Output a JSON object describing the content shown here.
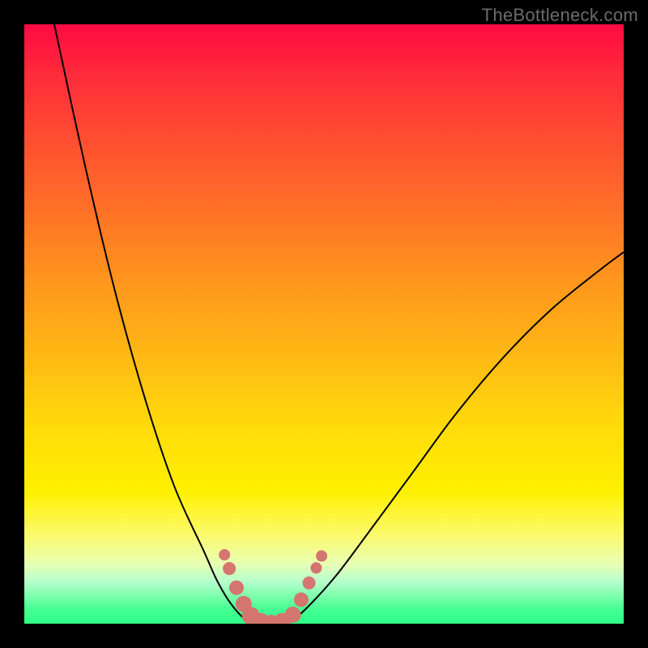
{
  "watermark": "TheBottleneck.com",
  "chart_data": {
    "type": "line",
    "title": "",
    "xlabel": "",
    "ylabel": "",
    "x_range": [
      0,
      1
    ],
    "y_range": [
      0,
      1
    ],
    "grid": false,
    "series": [
      {
        "name": "left-curve",
        "x": [
          0.05,
          0.1,
          0.15,
          0.2,
          0.25,
          0.3,
          0.32,
          0.34,
          0.36,
          0.378
        ],
        "y": [
          1.0,
          0.77,
          0.56,
          0.38,
          0.23,
          0.12,
          0.075,
          0.04,
          0.015,
          0.0
        ]
      },
      {
        "name": "trough",
        "x": [
          0.378,
          0.4,
          0.42,
          0.44
        ],
        "y": [
          0.0,
          0.0,
          0.0,
          0.0
        ]
      },
      {
        "name": "right-curve",
        "x": [
          0.44,
          0.47,
          0.52,
          0.58,
          0.65,
          0.72,
          0.8,
          0.88,
          0.96,
          1.0
        ],
        "y": [
          0.0,
          0.025,
          0.08,
          0.16,
          0.255,
          0.35,
          0.445,
          0.525,
          0.59,
          0.62
        ]
      }
    ],
    "markers": [
      {
        "x": 0.334,
        "y": 0.115,
        "r": 7
      },
      {
        "x": 0.342,
        "y": 0.092,
        "r": 8
      },
      {
        "x": 0.354,
        "y": 0.06,
        "r": 9
      },
      {
        "x": 0.366,
        "y": 0.033,
        "r": 10
      },
      {
        "x": 0.378,
        "y": 0.013,
        "r": 11
      },
      {
        "x": 0.395,
        "y": 0.003,
        "r": 11
      },
      {
        "x": 0.412,
        "y": 0.0,
        "r": 11
      },
      {
        "x": 0.43,
        "y": 0.003,
        "r": 11
      },
      {
        "x": 0.448,
        "y": 0.015,
        "r": 10
      },
      {
        "x": 0.462,
        "y": 0.04,
        "r": 9
      },
      {
        "x": 0.475,
        "y": 0.068,
        "r": 8
      },
      {
        "x": 0.487,
        "y": 0.093,
        "r": 7
      },
      {
        "x": 0.496,
        "y": 0.113,
        "r": 7
      }
    ]
  }
}
